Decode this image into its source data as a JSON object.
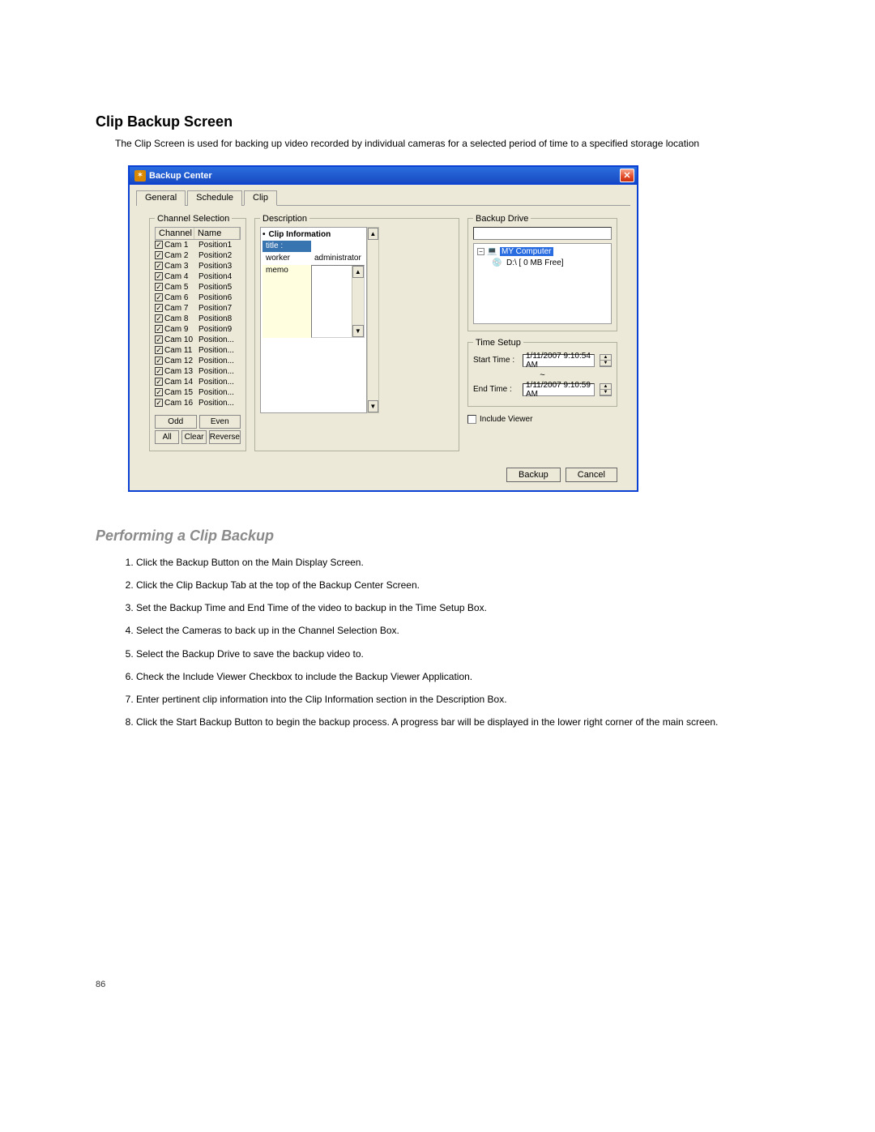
{
  "doc": {
    "heading": "Clip Backup Screen",
    "intro": "The Clip Screen is used for backing up video recorded by individual cameras for a selected period of time to a specified storage location",
    "subhead": "Performing a Clip Backup",
    "steps": [
      "Click the Backup Button on the Main Display Screen.",
      "Click the Clip Backup Tab at the top of the Backup Center Screen.",
      "Set the Backup Time and End Time of the video to backup in the Time Setup Box.",
      "Select the Cameras to back up in the Channel Selection Box.",
      "Select the Backup Drive to save the backup video to.",
      "Check the Include Viewer Checkbox to include the Backup Viewer Application.",
      "Enter pertinent clip information into the Clip Information section in the Description Box.",
      "Click the Start Backup Button to begin the backup process. A progress bar will be displayed in the lower right corner of the main screen."
    ],
    "page_number": "86"
  },
  "win": {
    "title": "Backup Center",
    "tabs": [
      "General",
      "Schedule",
      "Clip"
    ],
    "active_tab": 2,
    "chsel": {
      "legend": "Channel Selection",
      "hdr_channel": "Channel",
      "hdr_name": "Name",
      "rows": [
        {
          "ch": "Cam 1",
          "name": "Position1"
        },
        {
          "ch": "Cam 2",
          "name": "Position2"
        },
        {
          "ch": "Cam 3",
          "name": "Position3"
        },
        {
          "ch": "Cam 4",
          "name": "Position4"
        },
        {
          "ch": "Cam 5",
          "name": "Position5"
        },
        {
          "ch": "Cam 6",
          "name": "Position6"
        },
        {
          "ch": "Cam 7",
          "name": "Position7"
        },
        {
          "ch": "Cam 8",
          "name": "Position8"
        },
        {
          "ch": "Cam 9",
          "name": "Position9"
        },
        {
          "ch": "Cam 10",
          "name": "Position..."
        },
        {
          "ch": "Cam 11",
          "name": "Position..."
        },
        {
          "ch": "Cam 12",
          "name": "Position..."
        },
        {
          "ch": "Cam 13",
          "name": "Position..."
        },
        {
          "ch": "Cam 14",
          "name": "Position..."
        },
        {
          "ch": "Cam 15",
          "name": "Position..."
        },
        {
          "ch": "Cam 16",
          "name": "Position..."
        }
      ],
      "btn_odd": "Odd",
      "btn_even": "Even",
      "btn_all": "All",
      "btn_clear": "Clear",
      "btn_reverse": "Reverse"
    },
    "desc": {
      "legend": "Description",
      "clipinfo": "Clip Information",
      "title_key": "title :",
      "title_val": "",
      "worker_key": "worker",
      "worker_val": "administrator",
      "memo_key": "memo"
    },
    "drive": {
      "legend": "Backup Drive",
      "root": "MY Computer",
      "child": "D:\\ [ 0 MB Free]"
    },
    "time": {
      "legend": "Time Setup",
      "start_lbl": "Start Time :",
      "start_val": "1/11/2007   9:10:54 AM",
      "end_lbl": "End Time :",
      "end_val": "1/11/2007   9:10:59 AM",
      "tilde": "~"
    },
    "incl_viewer": "Include Viewer",
    "btn_backup": "Backup",
    "btn_cancel": "Cancel"
  }
}
